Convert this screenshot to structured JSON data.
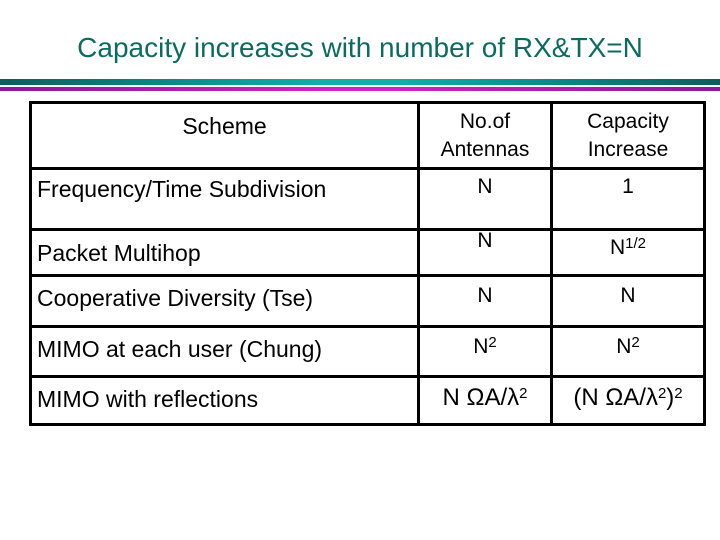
{
  "slide": {
    "title": "Capacity increases with number of RX&TX=N",
    "colors": {
      "title": "#0e6a60",
      "bar_top_edge": "#0b5e5c",
      "bar_top_center": "#10b0a8",
      "bar_bottom_edge": "#8e1890",
      "bar_bottom_center": "#d020c8"
    }
  },
  "table": {
    "headers": {
      "scheme": "Scheme",
      "antennas_line1": "No.of",
      "antennas_line2": "Antennas",
      "capacity_line1": "Capacity",
      "capacity_line2": "Increase"
    },
    "rows": [
      {
        "scheme": "Frequency/Time Subdivision",
        "antennas": "N",
        "antennas_sup": "",
        "capacity": "1",
        "capacity_sup": ""
      },
      {
        "scheme": "Packet Multihop",
        "antennas": "N",
        "antennas_sup": "",
        "capacity": "N",
        "capacity_sup": "1/2"
      },
      {
        "scheme": "Cooperative Diversity (Tse)",
        "antennas": "N",
        "antennas_sup": "",
        "capacity": "N",
        "capacity_sup": ""
      },
      {
        "scheme": "MIMO at each user (Chung)",
        "antennas": "N",
        "antennas_sup": "2",
        "capacity": "N",
        "capacity_sup": "2"
      },
      {
        "scheme": "MIMO with reflections",
        "antennas": "N ΩA/λ",
        "antennas_sup": "2",
        "capacity": "(N ΩA/λ",
        "capacity_sup": "2",
        "capacity_suffix": ")",
        "capacity_suffix_sup": "2"
      }
    ]
  }
}
